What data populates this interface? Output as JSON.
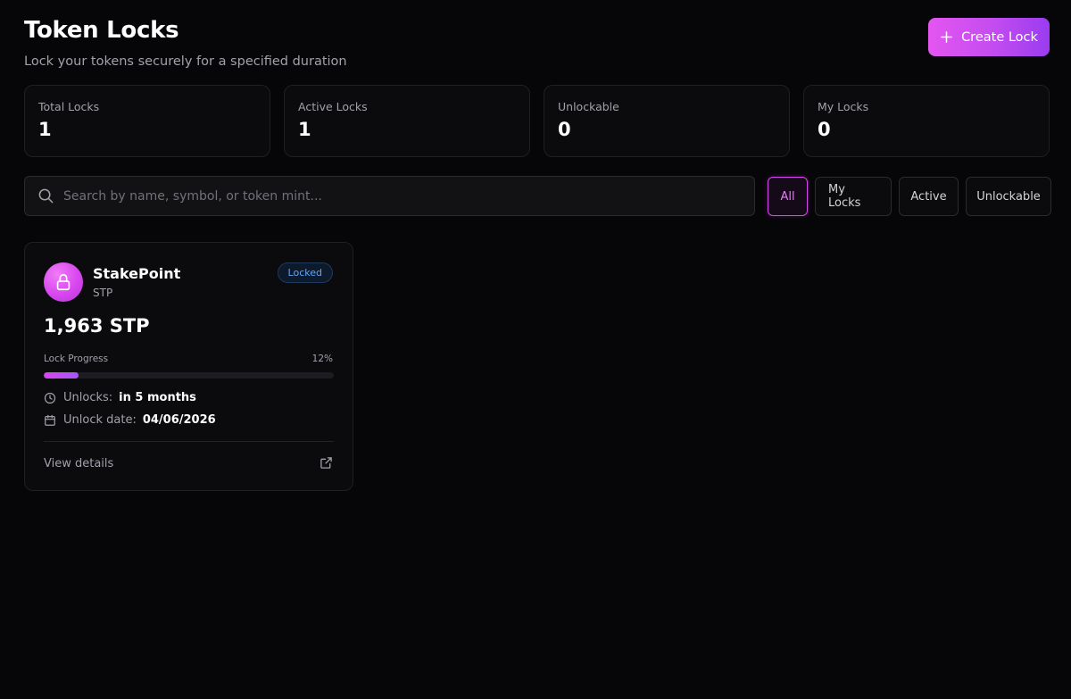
{
  "header": {
    "title": "Token Locks",
    "subtitle": "Lock your tokens securely for a specified duration",
    "create_button_label": "Create Lock"
  },
  "stats": [
    {
      "label": "Total Locks",
      "value": "1"
    },
    {
      "label": "Active Locks",
      "value": "1"
    },
    {
      "label": "Unlockable",
      "value": "0"
    },
    {
      "label": "My Locks",
      "value": "0"
    }
  ],
  "search": {
    "placeholder": "Search by name, symbol, or token mint...",
    "value": ""
  },
  "filters": [
    {
      "label": "All",
      "active": true
    },
    {
      "label": "My Locks",
      "active": false
    },
    {
      "label": "Active",
      "active": false
    },
    {
      "label": "Unlockable",
      "active": false
    }
  ],
  "locks": [
    {
      "token_name": "StakePoint",
      "token_symbol": "STP",
      "status": "Locked",
      "amount": "1,963 STP",
      "progress_label": "Lock Progress",
      "progress_text": "12%",
      "progress_fraction": 0.12,
      "unlocks_label": "Unlocks:",
      "unlocks_value": "in 5 months",
      "unlock_date_label": "Unlock date:",
      "unlock_date_value": "04/06/2026",
      "view_details_label": "View details",
      "avatar_icon": "lock-icon"
    }
  ],
  "colors": {
    "accent": "#d946ef",
    "accent_secondary": "#a855f7",
    "background": "#060608",
    "card": "#0b0b0e",
    "status_locked": "#60a5fa"
  }
}
